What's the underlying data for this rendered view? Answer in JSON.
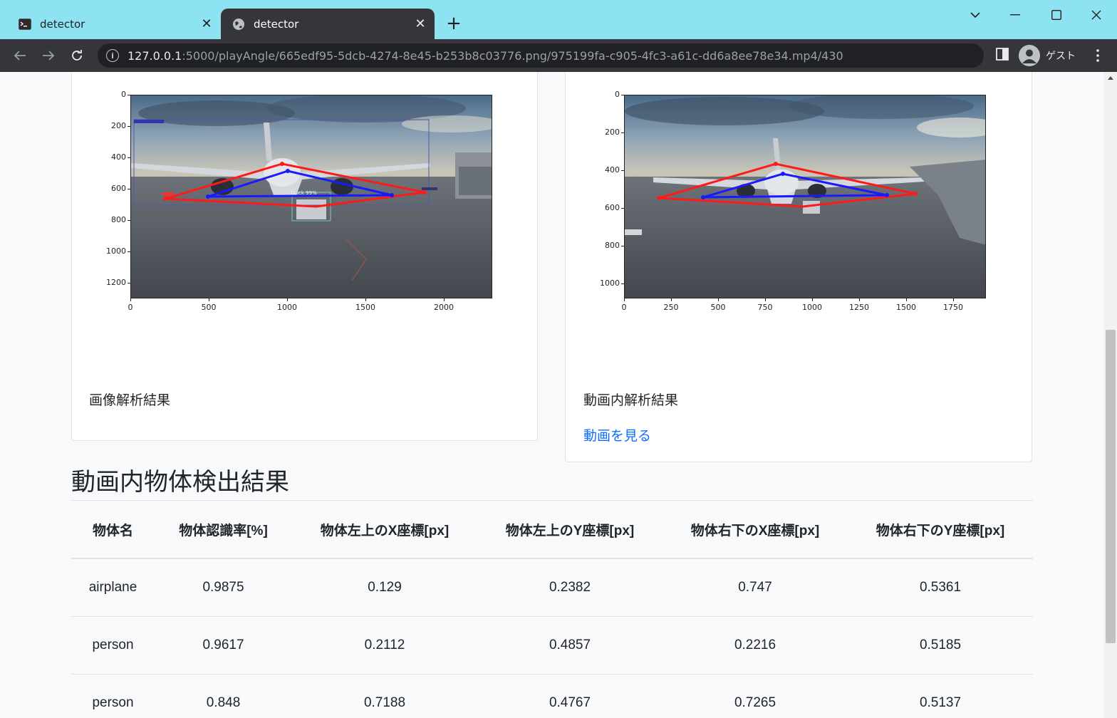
{
  "browser": {
    "tabs": [
      {
        "title": "detector",
        "active": false
      },
      {
        "title": "detector",
        "active": true
      }
    ],
    "url_host": "127.0.0.1",
    "url_path": ":5000/playAngle/665edf95-5dcb-4274-8e45-b253b8c03776.png/975199fa-c905-4fc3-a61c-dd6a8ee78e34.mp4/430",
    "profile_label": "ゲスト"
  },
  "colors": {
    "accent_link": "#0d6efd",
    "triangle_red": "#ff1a1a",
    "triangle_blue": "#1a1aff",
    "tab_bar": "#8ee3f2"
  },
  "image_card": {
    "caption": "画像解析結果",
    "plot": {
      "x_ticks": [
        "0",
        "500",
        "1000",
        "1500",
        "2000"
      ],
      "y_ticks": [
        "0",
        "200",
        "400",
        "600",
        "800",
        "1000",
        "1200"
      ],
      "truck_label": "truck 99%"
    }
  },
  "video_card": {
    "caption": "動画内解析結果",
    "link": "動画を見る",
    "plot": {
      "x_ticks": [
        "0",
        "250",
        "500",
        "750",
        "1000",
        "1250",
        "1500",
        "1750"
      ],
      "y_ticks": [
        "0",
        "200",
        "400",
        "600",
        "800",
        "1000"
      ]
    }
  },
  "section_title": "動画内物体検出結果",
  "table": {
    "headers": [
      "物体名",
      "物体認識率[%]",
      "物体左上のX座標[px]",
      "物体左上のY座標[px]",
      "物体右下のX座標[px]",
      "物体右下のY座標[px]"
    ],
    "rows": [
      [
        "airplane",
        "0.9875",
        "0.129",
        "0.2382",
        "0.747",
        "0.5361"
      ],
      [
        "person",
        "0.9617",
        "0.2112",
        "0.4857",
        "0.2216",
        "0.5185"
      ],
      [
        "person",
        "0.848",
        "0.7188",
        "0.4767",
        "0.7265",
        "0.5137"
      ]
    ]
  }
}
